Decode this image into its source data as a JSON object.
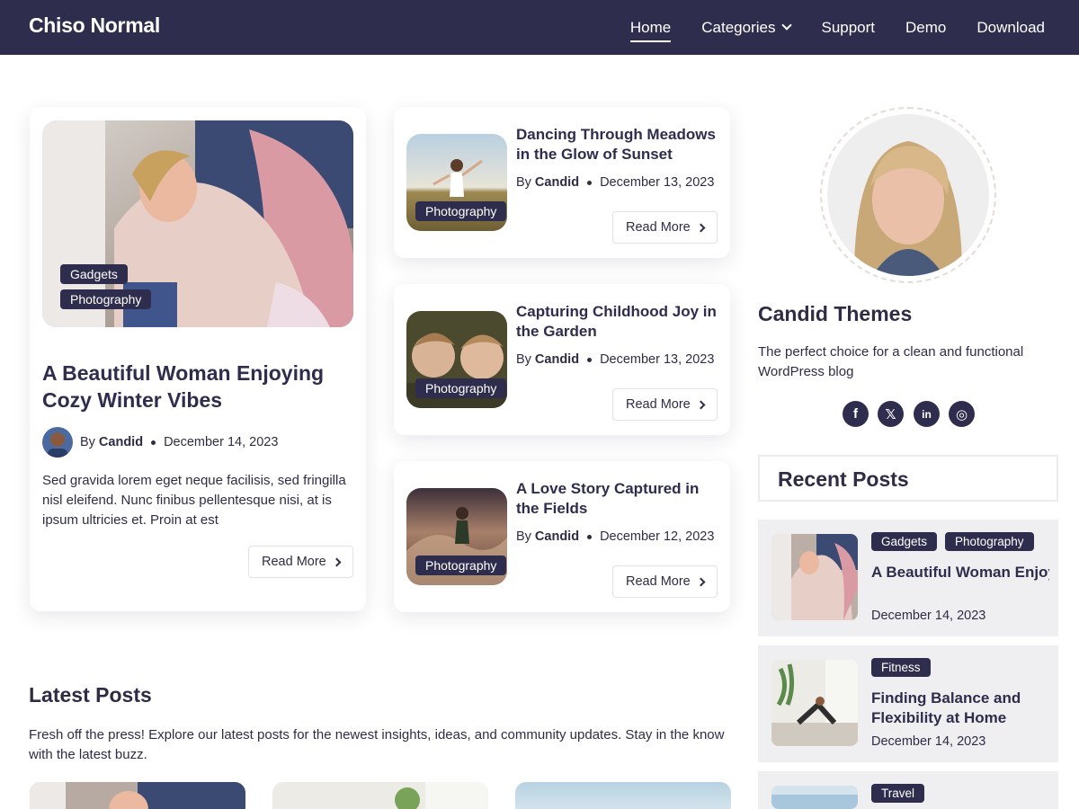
{
  "header": {
    "brand": "Chiso Normal",
    "nav": [
      {
        "label": "Home",
        "active": true
      },
      {
        "label": "Categories",
        "has_dropdown": true
      },
      {
        "label": "Support"
      },
      {
        "label": "Demo"
      },
      {
        "label": "Download"
      }
    ]
  },
  "featured": {
    "tags": [
      "Gadgets",
      "Photography"
    ],
    "title": "A Beautiful Woman Enjoying Cozy Winter Vibes",
    "by": "By",
    "author": "Candid",
    "date": "December 14, 2023",
    "excerpt": "Sed gravida lorem eget neque facilisis, sed fringilla nisl eleifend. Nunc finibus pellentesque nisi, at is ipsum ultricies et. Proin at est",
    "read_more": "Read More"
  },
  "posts": [
    {
      "tag": "Photography",
      "title": "Dancing Through Meadows in the Glow of Sunset",
      "by": "By",
      "author": "Candid",
      "date": "December 13, 2023",
      "read_more": "Read More"
    },
    {
      "tag": "Photography",
      "title": "Capturing Childhood Joy in the Garden",
      "by": "By",
      "author": "Candid",
      "date": "December 13, 2023",
      "read_more": "Read More"
    },
    {
      "tag": "Photography",
      "title": "A Love Story Captured in the Fields",
      "by": "By",
      "author": "Candid",
      "date": "December 12, 2023",
      "read_more": "Read More"
    }
  ],
  "sidebar": {
    "author_name": "Candid Themes",
    "author_bio": "The perfect choice for a clean and functional WordPress blog",
    "social": [
      {
        "icon": "facebook-icon",
        "glyph": "f"
      },
      {
        "icon": "x-icon",
        "glyph": "𝕏"
      },
      {
        "icon": "linkedin-icon",
        "glyph": "in"
      },
      {
        "icon": "instagram-icon",
        "glyph": "◎"
      }
    ],
    "recent_heading": "Recent Posts",
    "recent": [
      {
        "tags": [
          "Gadgets",
          "Photography"
        ],
        "title": "A Beautiful Woman Enjoying Cozy Winter…",
        "date": "December 14, 2023"
      },
      {
        "tags": [
          "Fitness"
        ],
        "title": "Finding Balance and Flexibility at Home",
        "date": "December 14, 2023"
      },
      {
        "tags": [
          "Travel"
        ],
        "title": "",
        "date": ""
      }
    ]
  },
  "latest": {
    "heading": "Latest Posts",
    "description": "Fresh off the press! Explore our latest posts for the newest insights, ideas, and community updates. Stay in the know with the latest buzz."
  },
  "colors": {
    "brand_dark": "#2e2d4d",
    "card_bg": "#ffffff",
    "recent_bg": "#efeff1"
  }
}
